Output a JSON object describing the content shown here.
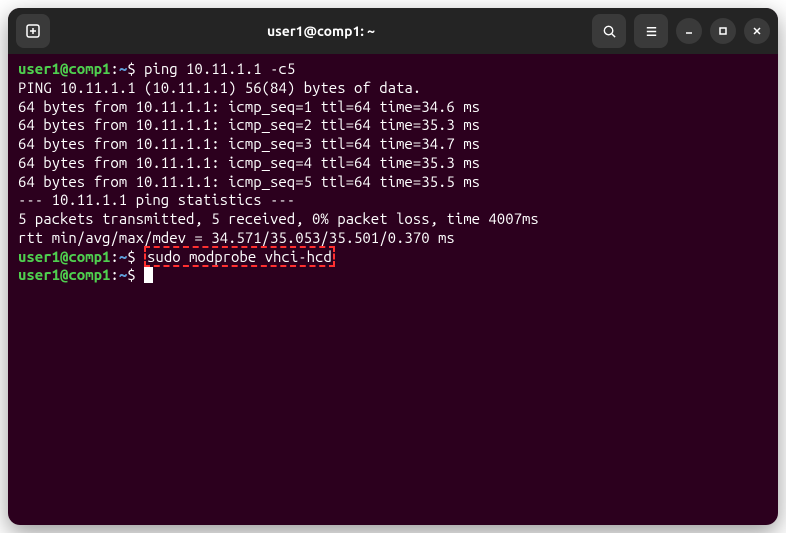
{
  "titlebar": {
    "title": "user1@comp1: ~"
  },
  "terminal": {
    "lines": [
      {
        "type": "prompt",
        "user": "user1@comp1",
        "path": "~",
        "command": "ping 10.11.1.1 -c5"
      },
      {
        "type": "output",
        "text": "PING 10.11.1.1 (10.11.1.1) 56(84) bytes of data."
      },
      {
        "type": "output",
        "text": "64 bytes from 10.11.1.1: icmp_seq=1 ttl=64 time=34.6 ms"
      },
      {
        "type": "output",
        "text": "64 bytes from 10.11.1.1: icmp_seq=2 ttl=64 time=35.3 ms"
      },
      {
        "type": "output",
        "text": "64 bytes from 10.11.1.1: icmp_seq=3 ttl=64 time=34.7 ms"
      },
      {
        "type": "output",
        "text": "64 bytes from 10.11.1.1: icmp_seq=4 ttl=64 time=35.3 ms"
      },
      {
        "type": "output",
        "text": "64 bytes from 10.11.1.1: icmp_seq=5 ttl=64 time=35.5 ms"
      },
      {
        "type": "output",
        "text": ""
      },
      {
        "type": "output",
        "text": "--- 10.11.1.1 ping statistics ---"
      },
      {
        "type": "output",
        "text": "5 packets transmitted, 5 received, 0% packet loss, time 4007ms"
      },
      {
        "type": "output",
        "text": "rtt min/avg/max/mdev = 34.571/35.053/35.501/0.370 ms"
      },
      {
        "type": "prompt-highlight",
        "user": "user1@comp1",
        "path": "~",
        "command": "sudo modprobe vhci-hcd"
      },
      {
        "type": "prompt-cursor",
        "user": "user1@comp1",
        "path": "~"
      }
    ]
  }
}
